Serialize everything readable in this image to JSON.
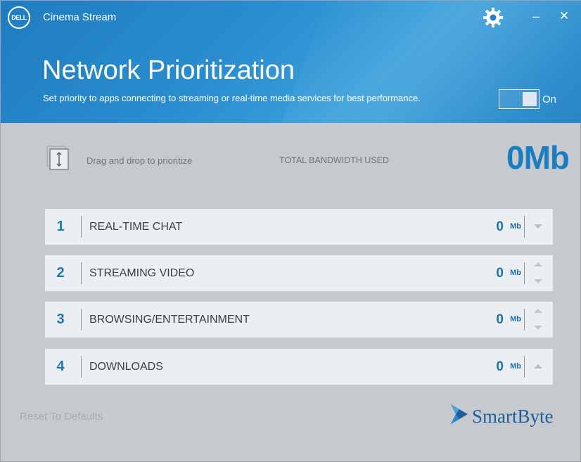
{
  "window": {
    "app_title": "Cinema Stream",
    "logo_text": "DELL",
    "minimize_glyph": "–",
    "close_glyph": "✕"
  },
  "header": {
    "title": "Network Prioritization",
    "subtitle": "Set priority to apps connecting to streaming or real-time media services for best performance.",
    "toggle_label": "On",
    "toggle_state": true
  },
  "toolbar": {
    "drag_hint": "Drag and drop to prioritize",
    "bandwidth_label": "TOTAL BANDWIDTH USED",
    "bandwidth_value": "0Mb"
  },
  "priorities": [
    {
      "rank": "1",
      "name": "REAL-TIME CHAT",
      "value": "0",
      "unit": "Mb",
      "can_move_up": false,
      "can_move_down": true
    },
    {
      "rank": "2",
      "name": "STREAMING VIDEO",
      "value": "0",
      "unit": "Mb",
      "can_move_up": true,
      "can_move_down": true
    },
    {
      "rank": "3",
      "name": "BROWSING/ENTERTAINMENT",
      "value": "0",
      "unit": "Mb",
      "can_move_up": true,
      "can_move_down": true
    },
    {
      "rank": "4",
      "name": "DOWNLOADS",
      "value": "0",
      "unit": "Mb",
      "can_move_up": true,
      "can_move_down": false
    }
  ],
  "footer": {
    "reset_label": "Reset To Defaults",
    "brand_name": "SmartByte"
  },
  "colors": {
    "header_blue": "#2a8dd0",
    "accent_blue": "#1a7dc1",
    "body_bg": "#c6cacf",
    "row_bg": "#eceff1"
  },
  "icons": {
    "settings": "gear-icon",
    "drag": "drag-drop-icon",
    "brand": "smartbyte-logo-icon"
  }
}
